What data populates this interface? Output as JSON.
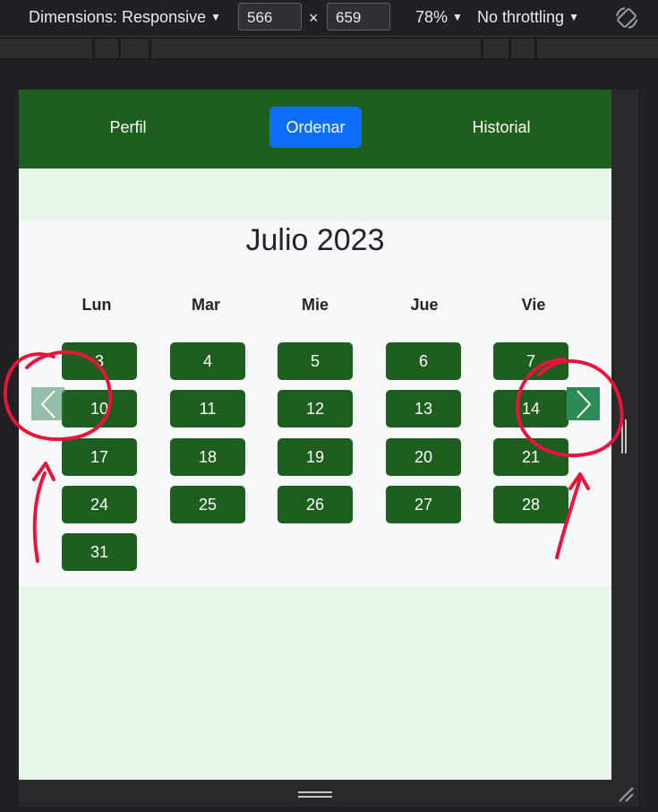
{
  "devtools": {
    "dimensions_label": "Dimensions: Responsive",
    "width_value": "566",
    "times": "×",
    "height_value": "659",
    "zoom": "78%",
    "throttle": "No throttling"
  },
  "nav": {
    "perfil": "Perfil",
    "ordenar": "Ordenar",
    "historial": "Historial",
    "active_color": "#0d6efd",
    "bar_color": "#1e5f20"
  },
  "calendar": {
    "title": "Julio 2023",
    "weekdays": [
      "Lun",
      "Mar",
      "Mie",
      "Jue",
      "Vie"
    ],
    "days": [
      [
        "3",
        "4",
        "5",
        "6",
        "7"
      ],
      [
        "10",
        "11",
        "12",
        "13",
        "14"
      ],
      [
        "17",
        "18",
        "19",
        "20",
        "21"
      ],
      [
        "24",
        "25",
        "26",
        "27",
        "28"
      ],
      [
        "31"
      ]
    ],
    "day_color": "#1e5f20",
    "prev_icon": "chevron-left-icon",
    "next_icon": "chevron-right-icon"
  },
  "annotation_color": "#e8143c"
}
